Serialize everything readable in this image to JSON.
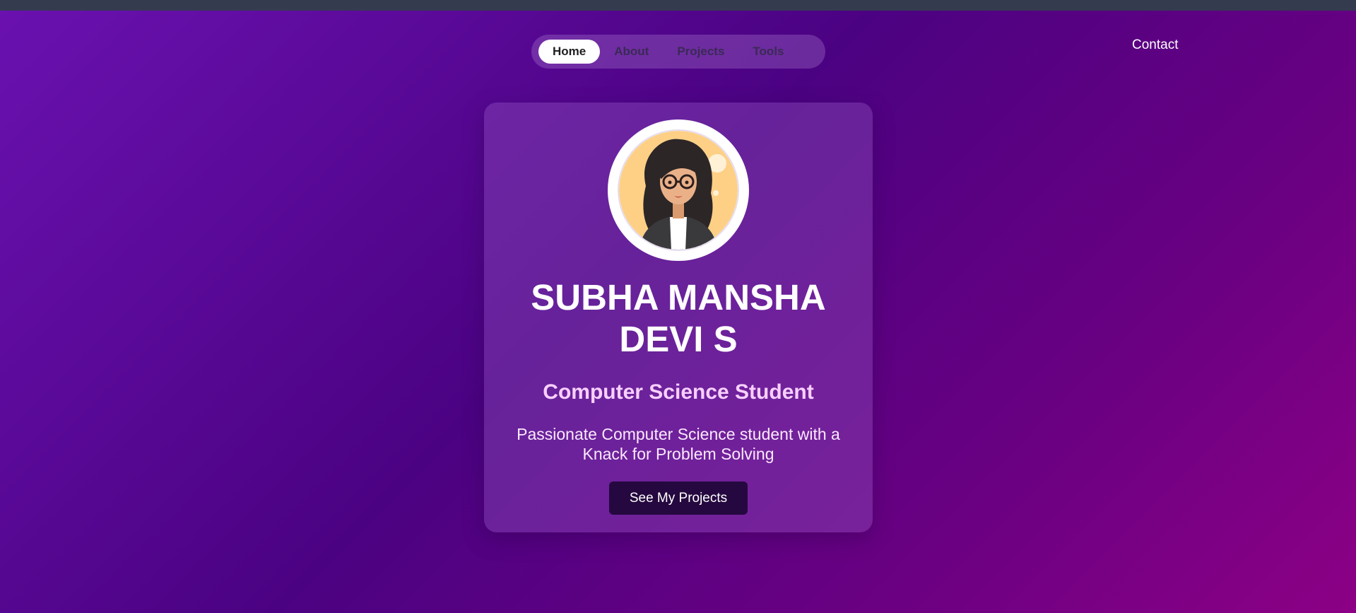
{
  "nav": {
    "items": [
      {
        "label": "Home",
        "active": true
      },
      {
        "label": "About",
        "active": false
      },
      {
        "label": "Projects",
        "active": false
      },
      {
        "label": "Tools",
        "active": false
      }
    ],
    "contact_label": "Contact"
  },
  "hero": {
    "name_line1": "SUBHA MANSHA",
    "name_line2": "DEVI S",
    "role": "Computer Science Student",
    "tagline_line1": "Passionate Computer Science student with a",
    "tagline_line2": "Knack for Problem Solving",
    "cta_label": "See My Projects"
  },
  "colors": {
    "background_start": "#6a11b0",
    "background_end": "#8c0085",
    "topbar": "#353b4f",
    "role_text": "#f8d0ff",
    "cta_background": "#25083f"
  }
}
